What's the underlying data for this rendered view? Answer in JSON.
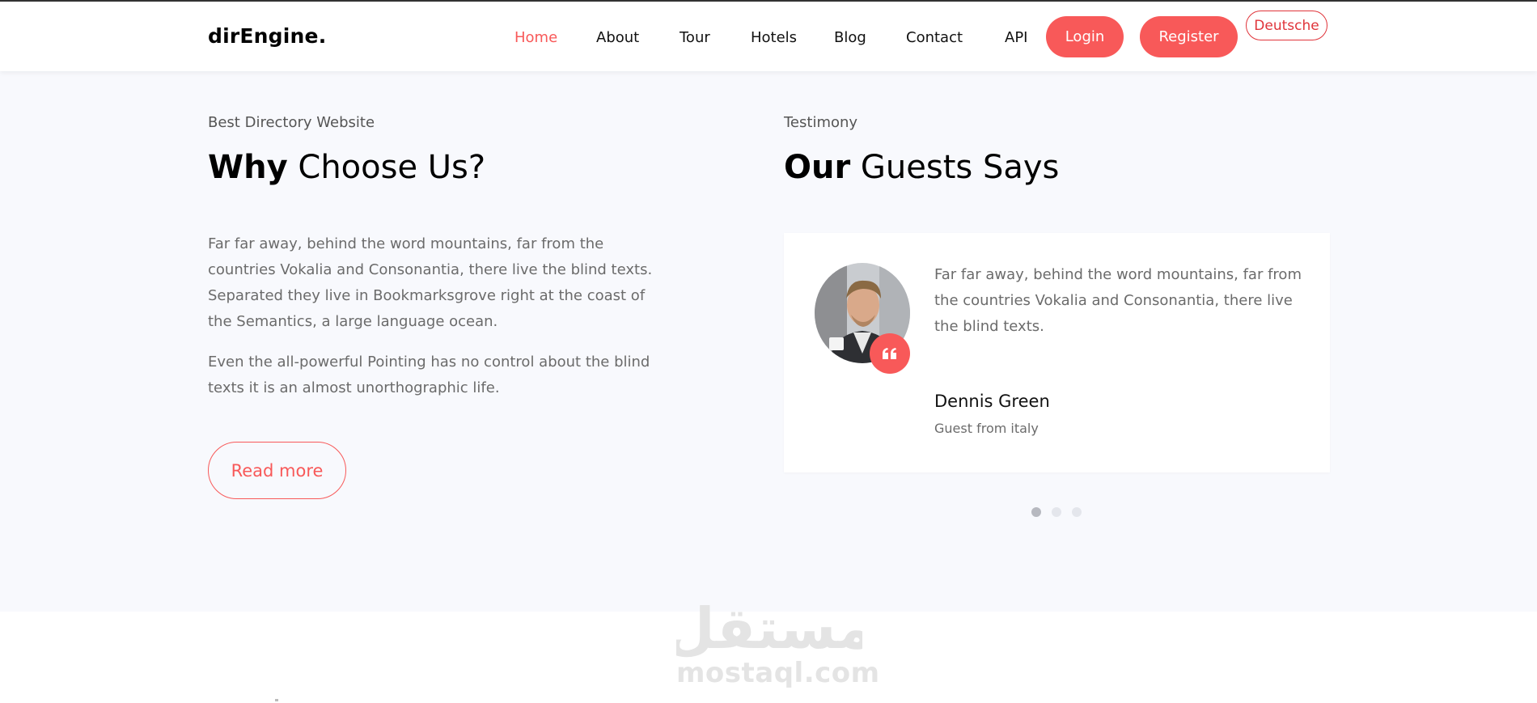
{
  "navbar": {
    "brand": "dirEngine.",
    "links": [
      "Home",
      "About",
      "Tour",
      "Hotels",
      "Blog",
      "Contact",
      "API"
    ],
    "active_link": "Home",
    "login_label": "Login",
    "register_label": "Register",
    "language_label": "Deutsche"
  },
  "why": {
    "subtitle": "Best Directory Website",
    "heading_bold": "Why",
    "heading_rest": " Choose Us?",
    "paragraph_1": "Far far away, behind the word mountains, far from the countries Vokalia and Consonantia, there live the blind texts. Separated they live in Bookmarksgrove right at the coast of the Semantics, a large language ocean.",
    "paragraph_2": "Even the all-powerful Pointing has no control about the blind texts it is an almost unorthographic life.",
    "read_more_label": "Read more"
  },
  "testimony": {
    "subtitle": "Testimony",
    "heading_bold": "Our",
    "heading_rest": " Guests Says",
    "quote": "Far far away, behind the word mountains, far from the countries Vokalia and Consonantia, there live the blind texts.",
    "name": "Dennis Green",
    "role": "Guest from italy",
    "slide_count": 3,
    "active_slide": 1
  },
  "watermark": {
    "arabic": "مستقل",
    "latin": "mostaql.com"
  },
  "colors": {
    "accent": "#f85959",
    "section_bg": "#f8f9fd"
  },
  "icons": [
    "quote-icon"
  ]
}
